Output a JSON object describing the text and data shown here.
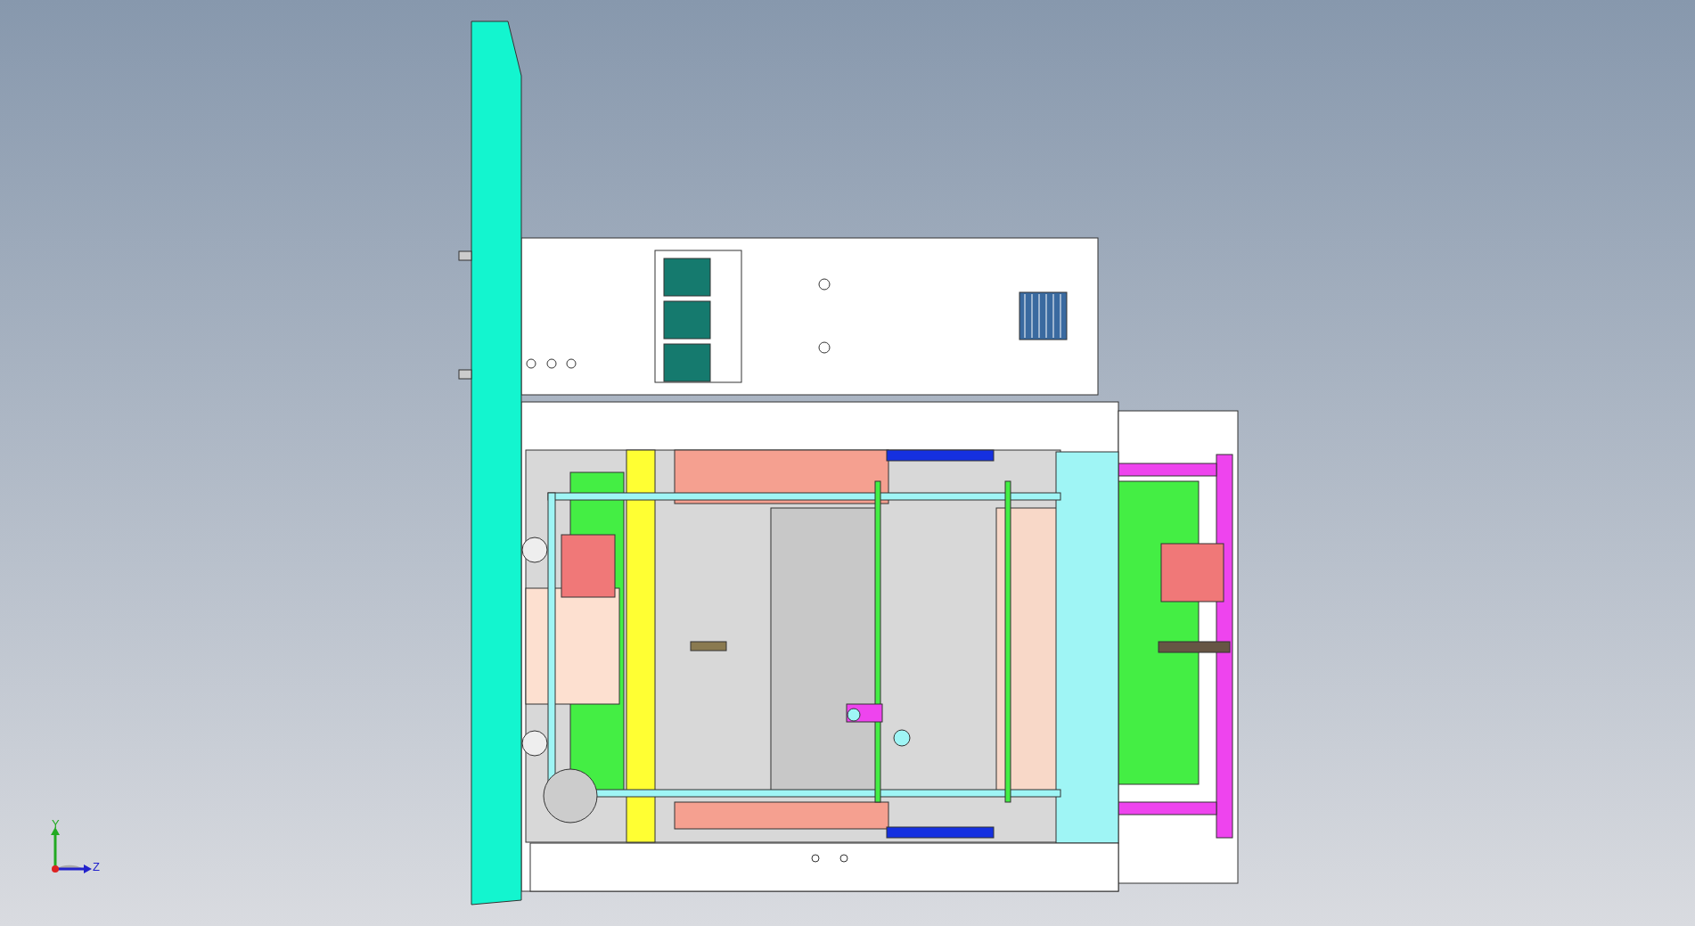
{
  "viewport": {
    "axis_triad": {
      "y_label": "Y",
      "z_label": "Z"
    }
  }
}
